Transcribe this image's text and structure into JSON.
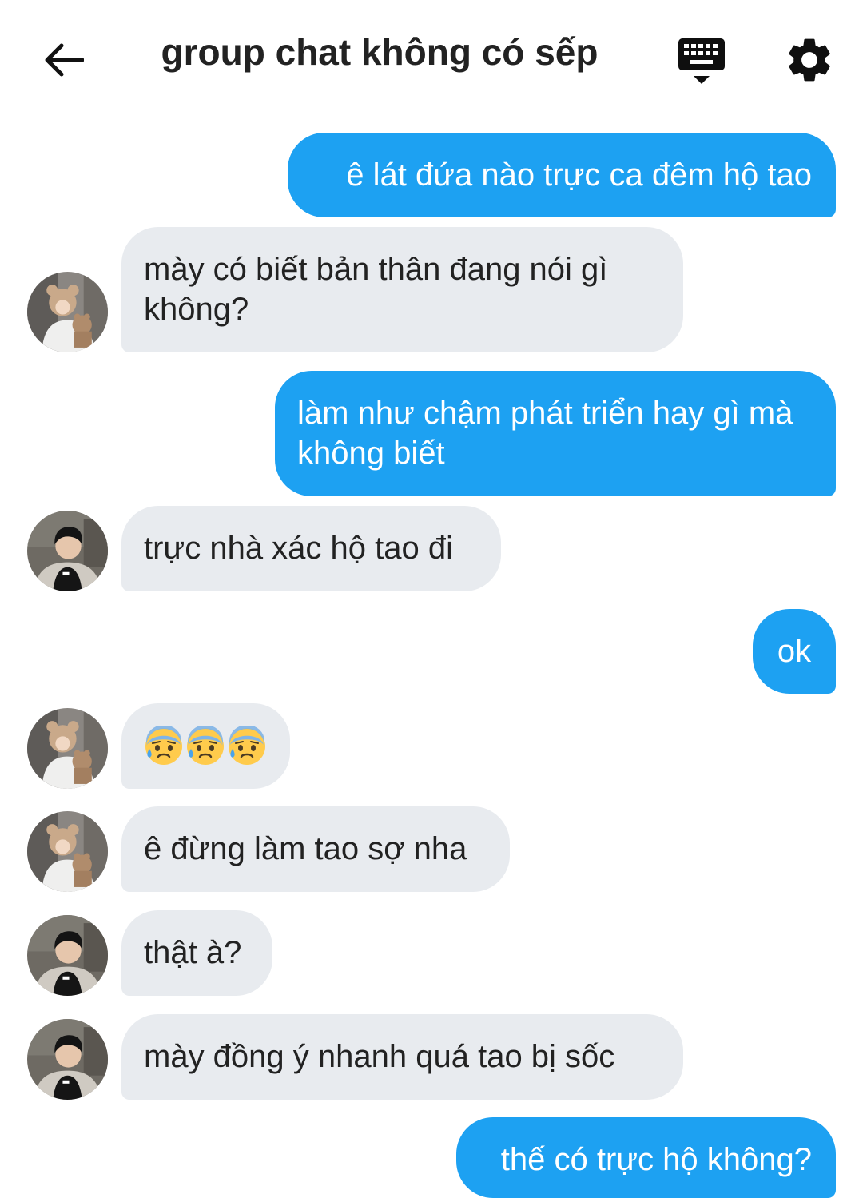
{
  "header": {
    "title": "group chat không có sếp",
    "back_icon": "arrow-left-icon",
    "keyboard_icon": "keyboard-icon",
    "settings_icon": "gear-icon"
  },
  "colors": {
    "sent_bubble": "#1da1f2",
    "received_bubble": "#e8ebef"
  },
  "messages": [
    {
      "from": "me",
      "text": "ê lát đứa nào trực ca đêm hộ tao"
    },
    {
      "from": "friend-bear-hat",
      "text": "mày có biết bản thân đang nói gì không?"
    },
    {
      "from": "me",
      "text": "làm như chậm phát triển hay gì mà không biết"
    },
    {
      "from": "friend-black-shirt",
      "text": "trực nhà xác hộ tao đi"
    },
    {
      "from": "me",
      "text": "ok"
    },
    {
      "from": "friend-bear-hat",
      "emoji": [
        "anxious-face-with-sweat-emoji",
        "anxious-face-with-sweat-emoji",
        "anxious-face-with-sweat-emoji"
      ]
    },
    {
      "from": "friend-bear-hat",
      "text": "ê đừng làm tao sợ nha"
    },
    {
      "from": "friend-black-shirt",
      "text": "thật à?"
    },
    {
      "from": "friend-black-shirt",
      "text": "mày đồng ý nhanh quá tao bị sốc"
    },
    {
      "from": "me",
      "text": "thế có trực hộ không?"
    }
  ]
}
